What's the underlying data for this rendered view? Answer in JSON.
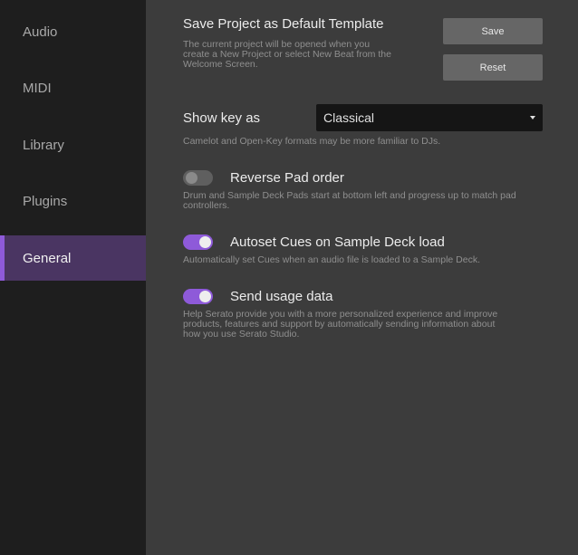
{
  "sidebar": {
    "items": [
      {
        "label": "Audio",
        "active": false
      },
      {
        "label": "MIDI",
        "active": false
      },
      {
        "label": "Library",
        "active": false
      },
      {
        "label": "Plugins",
        "active": false
      },
      {
        "label": "General",
        "active": true
      }
    ]
  },
  "template": {
    "title": "Save Project as Default Template",
    "desc_lines": [
      "The current project will be opened when you",
      "create a New Project or select New Beat from the",
      "Welcome Screen."
    ],
    "save_label": "Save",
    "reset_label": "Reset"
  },
  "key": {
    "label": "Show key as",
    "selected": "Classical",
    "desc": "Camelot and Open-Key formats may be more familiar to DJs."
  },
  "reverse_pad": {
    "label": "Reverse Pad order",
    "enabled": false,
    "desc_lines": [
      "Drum and Sample Deck Pads start at bottom left and progress up to match pad",
      "controllers."
    ]
  },
  "autoset_cues": {
    "label": "Autoset Cues on Sample Deck load",
    "enabled": true,
    "desc": "Automatically set Cues when an audio file is loaded to a Sample Deck."
  },
  "usage_data": {
    "label": "Send usage data",
    "enabled": true,
    "desc_lines": [
      "Help Serato provide you with a more personalized experience and improve",
      "products, features and support by automatically sending information about",
      "how you use Serato Studio."
    ]
  },
  "colors": {
    "accent": "#8e5ad9",
    "sidebar_bg": "#1e1e1e",
    "active_bg": "#4a3562",
    "panel_bg": "#3c3c3c"
  }
}
